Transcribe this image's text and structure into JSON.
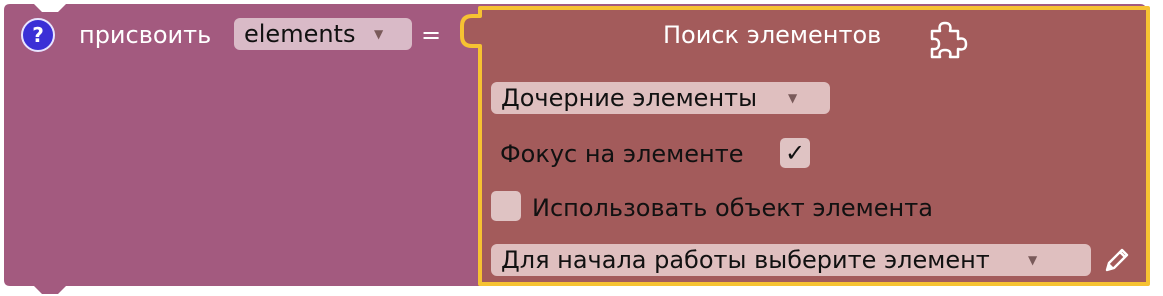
{
  "assign_block": {
    "help_symbol": "?",
    "assign_label": "присвоить",
    "variable_dropdown": "elements",
    "equals": "="
  },
  "find_block": {
    "title": "Поиск элементов",
    "search_type_dropdown": "Дочерние элементы",
    "focus_label": "Фокус на элементе",
    "focus_checked": "✓",
    "use_object_label": "Использовать объект элемента",
    "element_dropdown": "Для начала работы выберите элемент"
  },
  "dropdown_arrow": "▼",
  "colors": {
    "assign_block": "#a35a7f",
    "find_block": "#a35b5b",
    "selection_outline": "#f6c232"
  },
  "icons": [
    "help-icon",
    "puzzle-icon",
    "dropdown-arrow-icon",
    "checkmark-icon",
    "edit-pencil-icon"
  ]
}
